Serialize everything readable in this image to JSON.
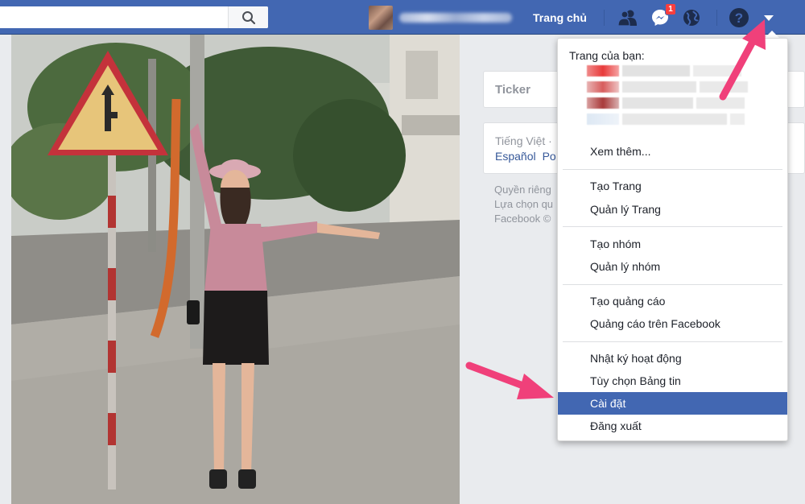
{
  "topbar": {
    "home_label": "Trang chủ",
    "messages_badge": "1",
    "icons": {
      "search": "search-icon",
      "friends": "friend-requests-icon",
      "messenger": "messenger-icon",
      "notifications": "globe-icon",
      "help": "help-icon",
      "menu": "caret-down-icon"
    }
  },
  "sidebar": {
    "ticker_title": "Ticker",
    "language_current": "Tiếng Việt ·",
    "language_links": [
      "Español",
      "Po"
    ],
    "footer_lines": [
      "Quyền riêng",
      "Lựa chọn qu",
      "Facebook ©"
    ]
  },
  "menu": {
    "header": "Trang của bạn:",
    "see_more": "Xem thêm...",
    "groups": [
      [
        "Tạo Trang",
        "Quản lý Trang"
      ],
      [
        "Tạo nhóm",
        "Quản lý nhóm"
      ],
      [
        "Tạo quảng cáo",
        "Quảng cáo trên Facebook"
      ],
      [
        "Nhật ký hoạt động",
        "Tùy chọn Bảng tin",
        "Cài đặt",
        "Đăng xuất"
      ]
    ],
    "highlighted_item": "Cài đặt"
  },
  "colors": {
    "brand_blue": "#4267b2",
    "highlight": "#4267b2",
    "annotation_arrow": "#f0407a",
    "badge_red": "#fa3e3e"
  }
}
